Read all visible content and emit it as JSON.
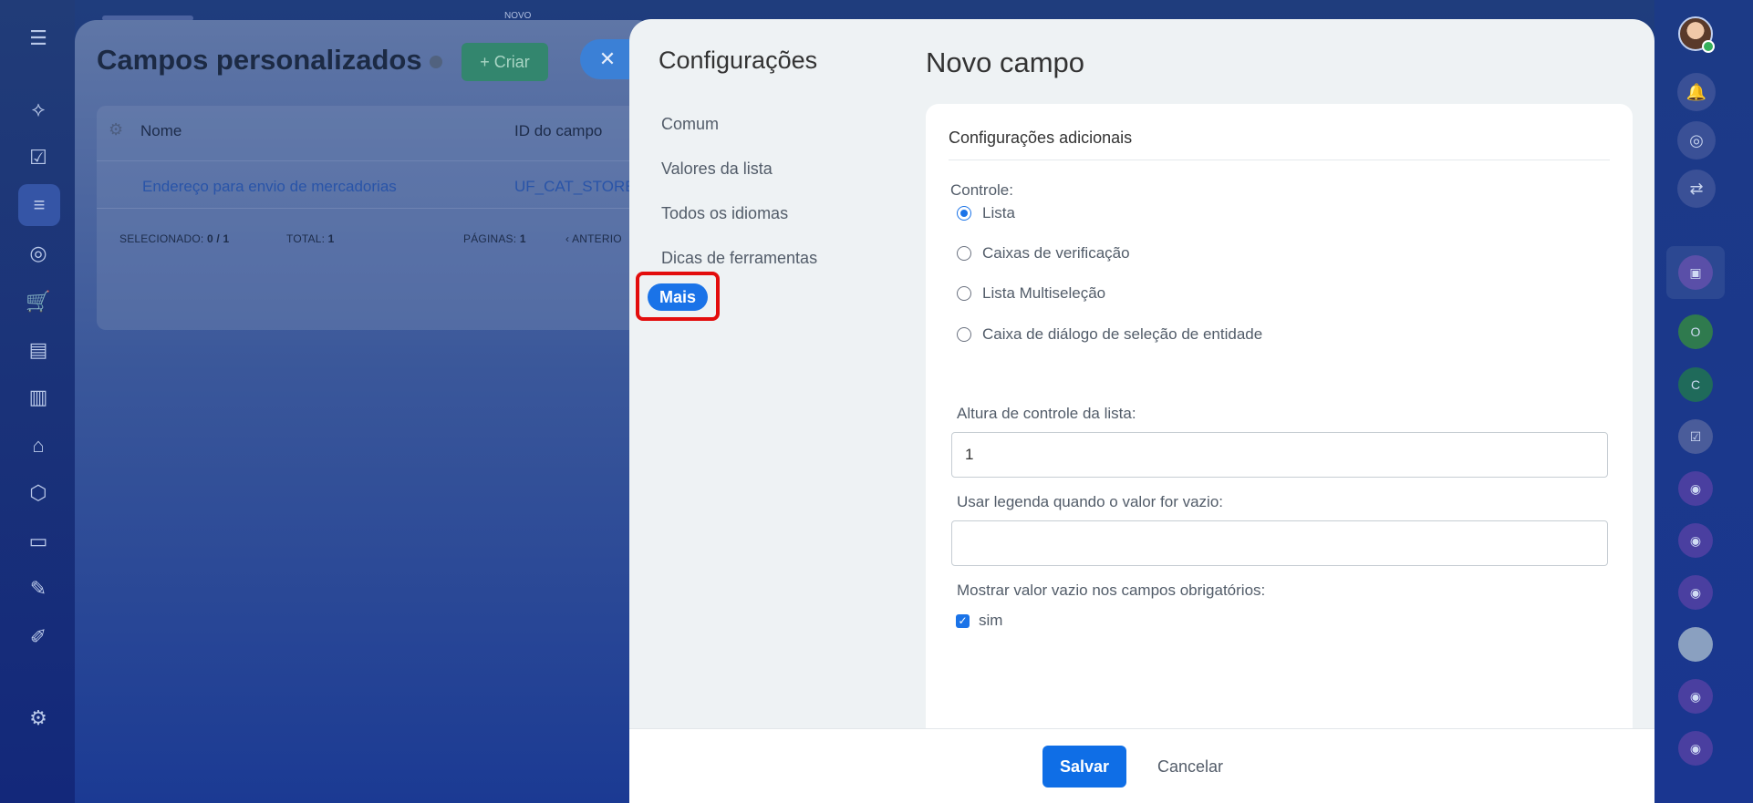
{
  "background": {
    "novo_label": "NOVO",
    "page_title": "Campos personalizados",
    "create_label": "+ Criar",
    "close_label": "✕",
    "table": {
      "col_name": "Nome",
      "col_id": "ID do campo",
      "row_name": "Endereço para envio de mercadorias",
      "row_id": "UF_CAT_STORE_",
      "footer": {
        "selected_label": "SELECIONADO:",
        "selected_value": "0 / 1",
        "total_label": "TOTAL:",
        "total_value": "1",
        "pages_label": "PÁGINAS:",
        "pages_value": "1",
        "prev_label": "‹ ANTERIO"
      }
    }
  },
  "settings_menu": {
    "title": "Configurações",
    "items": [
      {
        "label": "Comum"
      },
      {
        "label": "Valores da lista"
      },
      {
        "label": "Todos os idiomas"
      },
      {
        "label": "Dicas de ferramentas"
      }
    ],
    "active_item": "Mais"
  },
  "form": {
    "title": "Novo campo",
    "section_heading": "Configurações adicionais",
    "control_label": "Controle:",
    "control_options": [
      {
        "label": "Lista",
        "checked": true
      },
      {
        "label": "Caixas de verificação",
        "checked": false
      },
      {
        "label": "Lista Multiseleção",
        "checked": false
      },
      {
        "label": "Caixa de diálogo de seleção de entidade",
        "checked": false
      }
    ],
    "height_label": "Altura de controle da lista:",
    "height_value": "1",
    "empty_caption_label": "Usar legenda quando o valor for vazio:",
    "empty_caption_value": "",
    "show_empty_label": "Mostrar valor vazio nos campos obrigatórios:",
    "show_empty_checkbox_label": "sim",
    "show_empty_checked": true
  },
  "footer": {
    "save_label": "Salvar",
    "cancel_label": "Cancelar"
  },
  "colors": {
    "accent": "#1a73e8",
    "highlight_outline": "#e30d0d",
    "background_blue": "#1a3580"
  }
}
